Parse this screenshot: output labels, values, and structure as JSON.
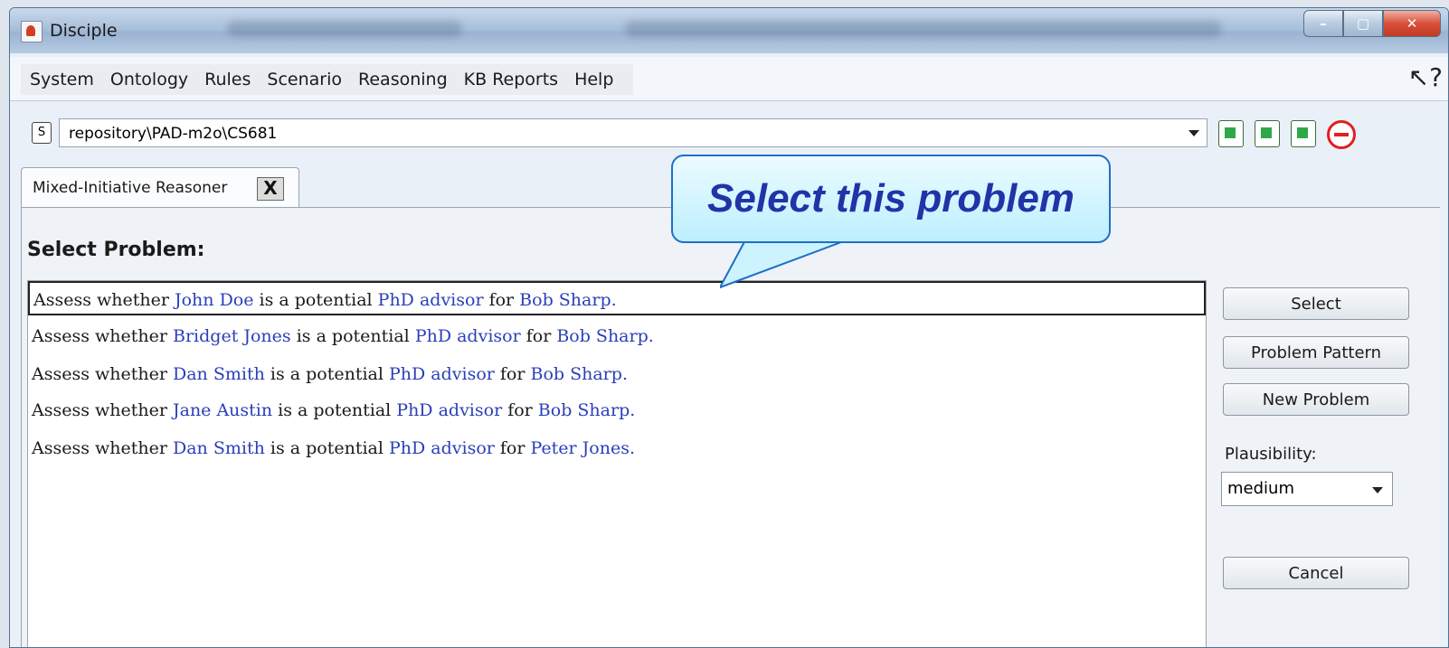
{
  "window": {
    "title": "Disciple"
  },
  "menu": [
    "System",
    "Ontology",
    "Rules",
    "Scenario",
    "Reasoning",
    "KB Reports",
    "Help"
  ],
  "repository": {
    "path": "repository\\PAD-m2o\\CS681"
  },
  "tab": {
    "label": "Mixed-Initiative Reasoner",
    "close": "X"
  },
  "panel": {
    "heading": "Select Problem:"
  },
  "problems": [
    {
      "pre": "Assess whether ",
      "a": "John Doe",
      "mid1": " is a potential ",
      "b": "PhD advisor",
      "mid2": " for ",
      "c": "Bob Sharp",
      "end": "."
    },
    {
      "pre": "Assess whether ",
      "a": "Bridget Jones",
      "mid1": " is a potential ",
      "b": "PhD advisor",
      "mid2": " for ",
      "c": "Bob Sharp",
      "end": "."
    },
    {
      "pre": "Assess whether ",
      "a": "Dan Smith",
      "mid1": " is a potential ",
      "b": "PhD advisor",
      "mid2": " for ",
      "c": "Bob Sharp",
      "end": "."
    },
    {
      "pre": "Assess whether ",
      "a": "Jane Austin",
      "mid1": " is a potential ",
      "b": "PhD advisor",
      "mid2": " for ",
      "c": "Bob Sharp",
      "end": "."
    },
    {
      "pre": "Assess whether ",
      "a": "Dan Smith",
      "mid1": " is a potential ",
      "b": "PhD advisor",
      "mid2": " for ",
      "c": "Peter Jones",
      "end": "."
    }
  ],
  "buttons": {
    "select": "Select",
    "pattern": "Problem Pattern",
    "new": "New Problem",
    "cancel": "Cancel"
  },
  "plausibility": {
    "label": "Plausibility:",
    "value": "medium"
  },
  "callout": {
    "text": "Select this problem"
  },
  "colors": {
    "entity": "#2a3fb8",
    "callout_border": "#1d6fc9",
    "callout_text": "#2233a8"
  }
}
